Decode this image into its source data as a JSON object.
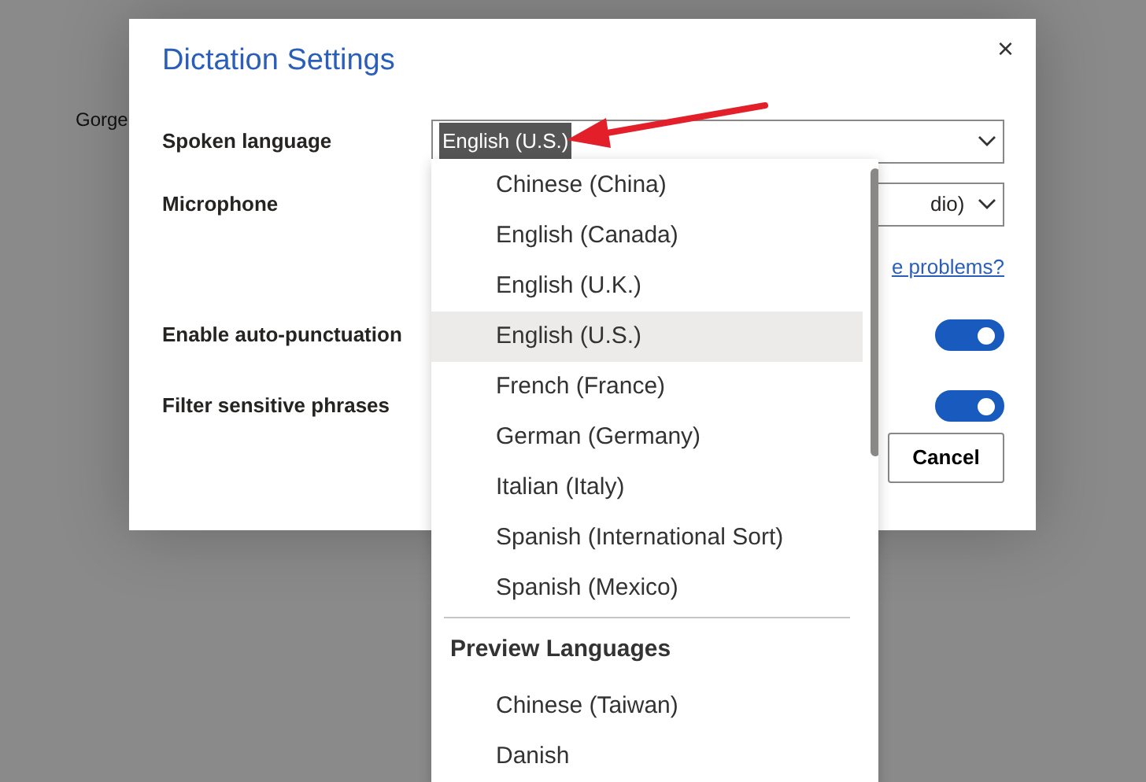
{
  "background_text": "Gorge",
  "dialog": {
    "title": "Dictation Settings",
    "close": "×"
  },
  "spoken_language": {
    "label": "Spoken language",
    "value": "English (U.S.)"
  },
  "microphone": {
    "label": "Microphone",
    "value": "dio)"
  },
  "help_link": "e problems?",
  "toggles": [
    {
      "label": "Enable auto-punctuation",
      "on": true
    },
    {
      "label": "Filter sensitive phrases",
      "on": true
    }
  ],
  "buttons": [
    "Cancel"
  ],
  "dropdown": {
    "groups": [
      {
        "items": [
          {
            "label": "Chinese (China)",
            "selected": false
          },
          {
            "label": "English (Canada)",
            "selected": false
          },
          {
            "label": "English (U.K.)",
            "selected": false
          },
          {
            "label": "English (U.S.)",
            "selected": true
          },
          {
            "label": "French (France)",
            "selected": false
          },
          {
            "label": "German (Germany)",
            "selected": false
          },
          {
            "label": "Italian (Italy)",
            "selected": false
          },
          {
            "label": "Spanish (International Sort)",
            "selected": false
          },
          {
            "label": "Spanish (Mexico)",
            "selected": false
          }
        ]
      },
      {
        "header": "Preview Languages",
        "items": [
          {
            "label": "Chinese (Taiwan)",
            "selected": false
          },
          {
            "label": "Danish",
            "selected": false
          }
        ]
      }
    ]
  }
}
